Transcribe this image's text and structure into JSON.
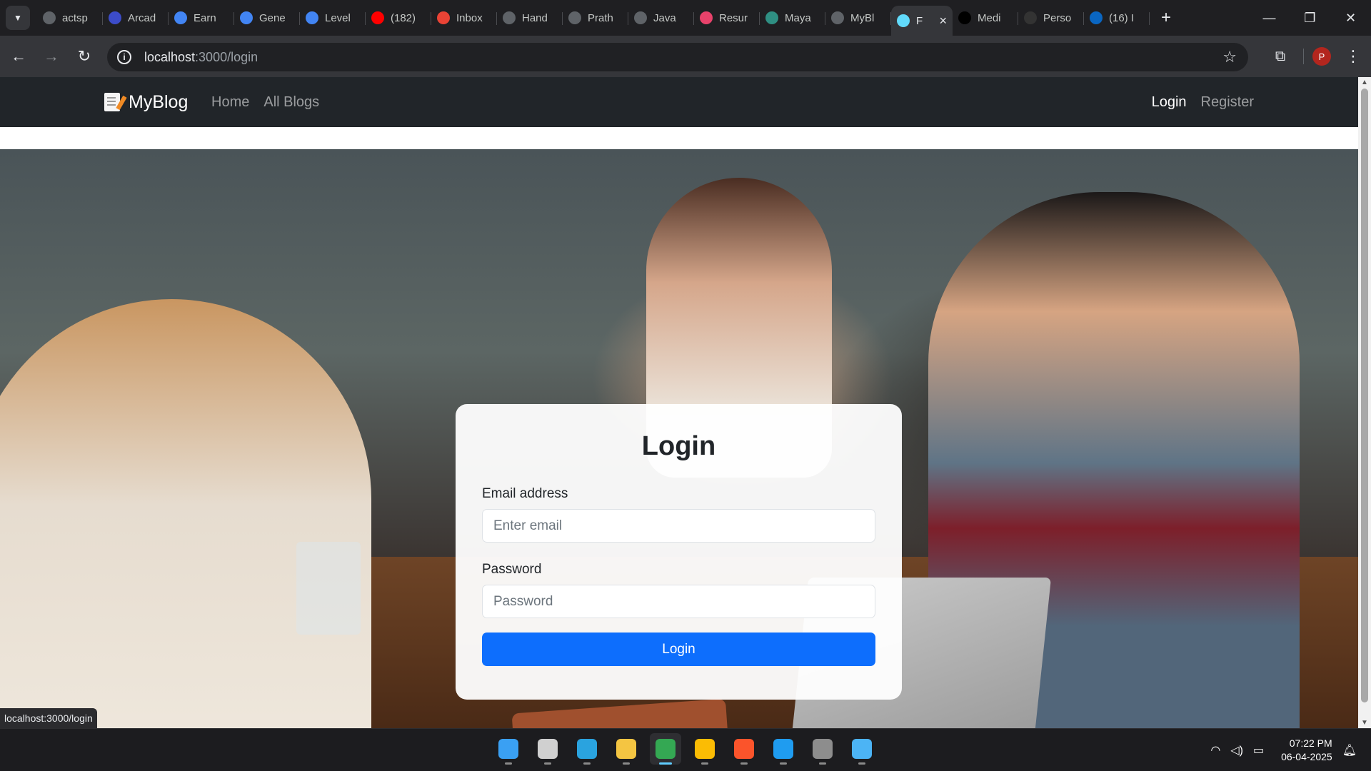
{
  "browser": {
    "tabs": [
      {
        "title": "actsp",
        "favicon": "feather-icon",
        "color": "#5f6368"
      },
      {
        "title": "Arcad",
        "favicon": "arcade-icon",
        "color": "#3c4cc9"
      },
      {
        "title": "Earn",
        "favicon": "google-cloud-icon",
        "color": "#4285f4"
      },
      {
        "title": "Gene",
        "favicon": "google-cloud-icon",
        "color": "#4285f4"
      },
      {
        "title": "Level",
        "favicon": "google-cloud-icon",
        "color": "#4285f4"
      },
      {
        "title": "(182)",
        "favicon": "youtube-icon",
        "color": "#ff0000"
      },
      {
        "title": "Inbox",
        "favicon": "gmail-icon",
        "color": "#ea4335"
      },
      {
        "title": "Hand",
        "favicon": "openai-icon",
        "color": "#5f6368"
      },
      {
        "title": "Prath",
        "favicon": "github-icon",
        "color": "#5f6368"
      },
      {
        "title": "Java",
        "favicon": "openai-icon",
        "color": "#5f6368"
      },
      {
        "title": "Resur",
        "favicon": "resume-icon",
        "color": "#e8426b"
      },
      {
        "title": "Maya",
        "favicon": "maya-icon",
        "color": "#2f8f83"
      },
      {
        "title": "MyBl",
        "favicon": "openai-icon",
        "color": "#5f6368"
      },
      {
        "title": "F",
        "favicon": "react-icon",
        "color": "#61dafb",
        "active": true
      },
      {
        "title": "Medi",
        "favicon": "medium-icon",
        "color": "#000000"
      },
      {
        "title": "Perso",
        "favicon": "briefcase-icon",
        "color": "#333333"
      },
      {
        "title": "(16) I",
        "favicon": "linkedin-icon",
        "color": "#0a66c2"
      }
    ],
    "url_host": "localhost",
    "url_path": ":3000/login",
    "profile_initial": "P",
    "status_url": "localhost:3000/login"
  },
  "app": {
    "brand": "MyBlog",
    "nav_left": [
      "Home",
      "All Blogs"
    ],
    "nav_right": [
      "Login",
      "Register"
    ]
  },
  "login": {
    "title": "Login",
    "email_label": "Email address",
    "email_placeholder": "Enter email",
    "password_label": "Password",
    "password_placeholder": "Password",
    "submit_label": "Login"
  },
  "taskbar": {
    "apps": [
      {
        "name": "windows-start-icon",
        "color": "#3aa0f3"
      },
      {
        "name": "task-view-icon",
        "color": "#d0d0d0"
      },
      {
        "name": "telegram-icon",
        "color": "#2aa3df"
      },
      {
        "name": "file-explorer-icon",
        "color": "#f4c542"
      },
      {
        "name": "chrome-profile-icon",
        "color": "#34a853",
        "active": true
      },
      {
        "name": "chrome-icon",
        "color": "#fbbc04"
      },
      {
        "name": "brave-icon",
        "color": "#fb542b"
      },
      {
        "name": "vscode-icon",
        "color": "#1f9cf0"
      },
      {
        "name": "settings-icon",
        "color": "#8d8d8d"
      },
      {
        "name": "notepad-icon",
        "color": "#4cb4f5"
      }
    ],
    "time": "07:22 PM",
    "date": "06-04-2025"
  },
  "colors": {
    "navbar_bg": "#212529",
    "primary_button": "#0d6efd"
  }
}
